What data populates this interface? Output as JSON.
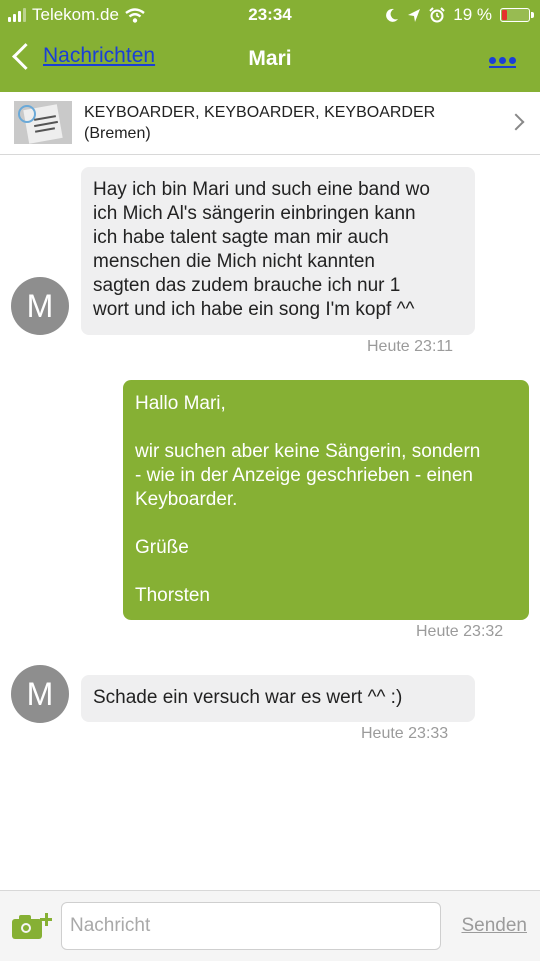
{
  "status_bar": {
    "carrier": "Telekom.de",
    "time": "23:34",
    "battery_text": "19 %",
    "battery_level": 0.19,
    "battery_color": "#e5322d"
  },
  "nav": {
    "back_label": "Nachrichten",
    "title": "Mari"
  },
  "ad": {
    "title": "KEYBOARDER, KEYBOARDER, KEYBOARDER",
    "location": "(Bremen)"
  },
  "messages": [
    {
      "direction": "incoming",
      "avatar_letter": "M",
      "text": "Hay ich bin Mari und such eine band wo\nich Mich Al's sängerin einbringen kann\nich habe talent sagte man mir auch\nmenschen die Mich nicht kannten\nsagten das zudem brauche ich nur 1\nwort und ich habe ein song I'm kopf ^^",
      "timestamp": "Heute 23:11"
    },
    {
      "direction": "outgoing",
      "text": "Hallo Mari,\n\nwir suchen aber keine Sängerin, sondern\n- wie in der Anzeige geschrieben - einen\nKeyboarder.\n\nGrüße\n\nThorsten",
      "timestamp": "Heute 23:32"
    },
    {
      "direction": "incoming",
      "avatar_letter": "M",
      "text": "Schade ein versuch war es wert ^^ :)",
      "timestamp": "Heute 23:33"
    }
  ],
  "composer": {
    "placeholder": "Nachricht",
    "value": "",
    "send_label": "Senden"
  },
  "colors": {
    "brand_green": "#86b034",
    "link_blue": "#1a3fd6",
    "incoming_bubble": "#efeff0"
  }
}
